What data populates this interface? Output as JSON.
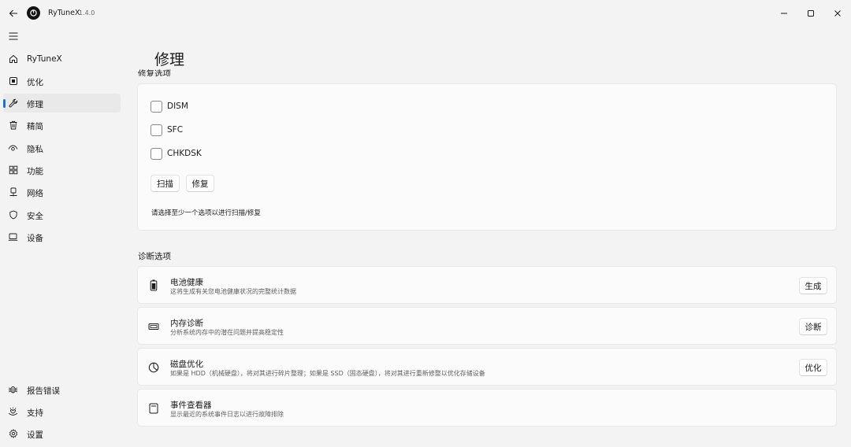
{
  "titlebar": {
    "app_name": "RyTuneX",
    "version": "1.4.0",
    "back_icon": "arrow-left-icon",
    "minimize_icon": "minimize-icon",
    "maximize_icon": "maximize-icon",
    "close_icon": "close-icon"
  },
  "sidebar": {
    "menu_icon": "hamburger-icon",
    "items": [
      {
        "label": "RyTuneX",
        "icon": "home-icon"
      },
      {
        "label": "优化",
        "icon": "optimize-icon"
      },
      {
        "label": "修理",
        "icon": "wrench-icon",
        "active": true
      },
      {
        "label": "精简",
        "icon": "trash-icon"
      },
      {
        "label": "隐私",
        "icon": "eye-icon"
      },
      {
        "label": "功能",
        "icon": "features-icon"
      },
      {
        "label": "网络",
        "icon": "network-icon"
      },
      {
        "label": "安全",
        "icon": "shield-icon"
      },
      {
        "label": "设备",
        "icon": "laptop-icon"
      }
    ],
    "footer_items": [
      {
        "label": "报告错误",
        "icon": "bug-icon"
      },
      {
        "label": "支持",
        "icon": "heart-hands-icon"
      },
      {
        "label": "设置",
        "icon": "gear-icon"
      }
    ]
  },
  "main": {
    "page_title": "修理",
    "repair_section_heading": "修复选项",
    "repair_options": [
      {
        "label": "DISM",
        "checked": false
      },
      {
        "label": "SFC",
        "checked": false
      },
      {
        "label": "CHKDSK",
        "checked": false
      }
    ],
    "scan_button": "扫描",
    "repair_button": "修复",
    "hint": "请选择至少一个选项以进行扫描/修复",
    "diagnostics_heading": "诊断选项",
    "diagnostics": [
      {
        "title": "电池健康",
        "description": "这将生成有关您电池健康状况的完整统计数据",
        "button": "生成",
        "icon": "battery-icon"
      },
      {
        "title": "内存诊断",
        "description": "分析系统内存中的潜在问题并提高稳定性",
        "button": "诊断",
        "icon": "memory-icon"
      },
      {
        "title": "磁盘优化",
        "description": "如果是 HDD（机械硬盘），将对其进行碎片整理；如果是 SSD（固态硬盘），将对其进行重新修整以优化存储设备",
        "button": "优化",
        "icon": "pie-chart-icon"
      },
      {
        "title": "事件查看器",
        "description": "显示最近的系统事件日志以进行故障排除",
        "button": "",
        "icon": "event-viewer-icon"
      }
    ]
  },
  "colors": {
    "accent": "#1a73c9",
    "background": "#f3f3f3",
    "card": "#fbfbfb"
  }
}
